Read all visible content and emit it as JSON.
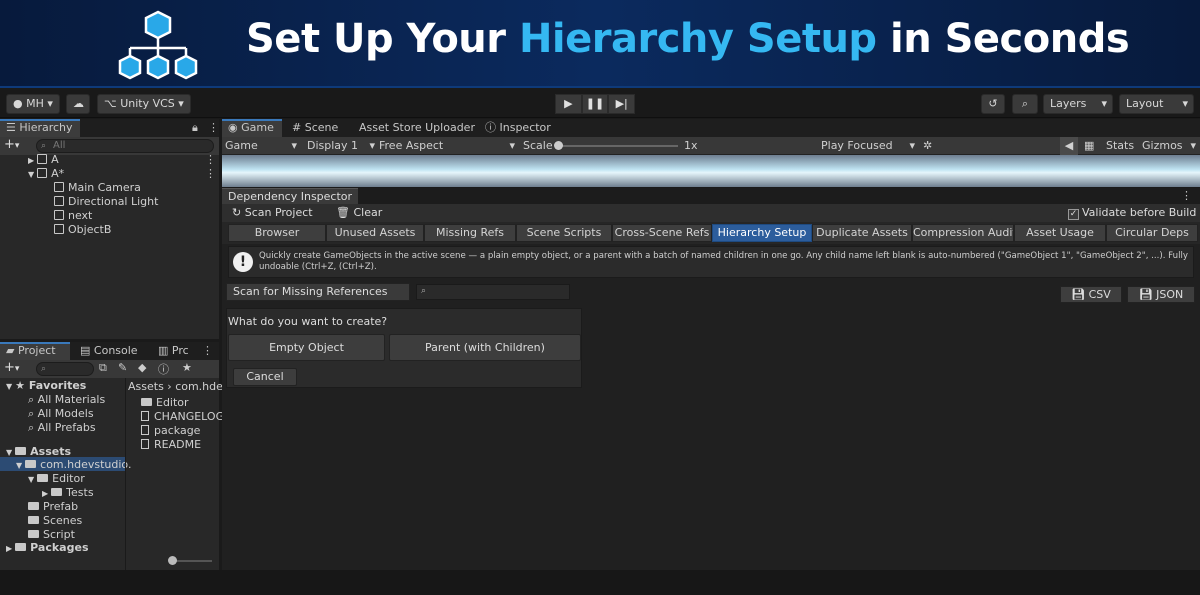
{
  "banner": {
    "title_part1": "Set Up Your ",
    "title_highlight": "Hierarchy Setup",
    "title_part2": " in Seconds"
  },
  "topbar": {
    "account": "MH ▾",
    "vcs": "Unity VCS ▾",
    "layers": "Layers",
    "layout": "Layout"
  },
  "hierarchy": {
    "tab": "Hierarchy",
    "search_placeholder": "All",
    "items": [
      {
        "label": "A",
        "expanded": false
      },
      {
        "label": "A*",
        "expanded": true
      },
      {
        "label": "Main Camera"
      },
      {
        "label": "Directional Light"
      },
      {
        "label": "next"
      },
      {
        "label": "ObjectB"
      }
    ]
  },
  "project": {
    "tabs": [
      "Project",
      "Console",
      "Prc"
    ],
    "favorites": "Favorites",
    "fav_items": [
      "All Materials",
      "All Models",
      "All Prefabs"
    ],
    "assets": "Assets",
    "asset_tree": [
      "com.hdevstudio.",
      "Editor",
      "Tests",
      "Prefab",
      "Scenes",
      "Script"
    ],
    "packages": "Packages",
    "breadcrumb": "Assets › com.hdevs",
    "files": [
      "Editor",
      "CHANGELOG",
      "package",
      "README"
    ]
  },
  "game": {
    "tabs": [
      "Game",
      "Scene",
      "Asset Store Uploader",
      "Inspector"
    ],
    "display_mode": "Game",
    "display": "Display 1",
    "aspect": "Free Aspect",
    "scale_label": "Scale",
    "scale_value": "1x",
    "play_mode": "Play Focused",
    "stats": "Stats",
    "gizmos": "Gizmos"
  },
  "dependency": {
    "tab": "Dependency Inspector",
    "scan_project": "Scan Project",
    "clear": "Clear",
    "validate": "Validate before Build",
    "tabs": [
      "Browser",
      "Unused Assets",
      "Missing Refs",
      "Scene Scripts",
      "Cross-Scene Refs",
      "Hierarchy Setup",
      "Duplicate Assets",
      "Compression Audit",
      "Asset Usage",
      "Circular Deps"
    ],
    "selected_tab": "Hierarchy Setup",
    "info": "Quickly create GameObjects in the active scene — a plain empty object, or a parent with a batch of named children in one go. Any child name left blank is auto-numbered (\"GameObject 1\", \"GameObject 2\", ...). Fully undoable (Ctrl+Z, (Ctrl+Z).",
    "scan_missing": "Scan for Missing References",
    "csv": "CSV",
    "json": "JSON",
    "question": "What do you want to create?",
    "empty_object": "Empty Object",
    "parent_children": "Parent (with Children)",
    "cancel": "Cancel"
  }
}
